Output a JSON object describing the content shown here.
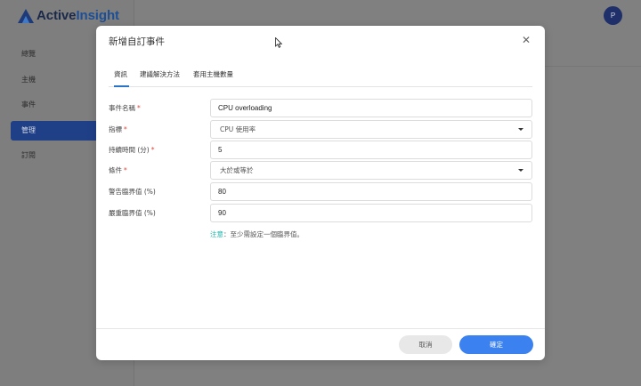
{
  "app": {
    "logo_part1": "Active",
    "logo_part2": "Insight",
    "avatar_initial": "P"
  },
  "sidebar": {
    "items": [
      {
        "label": "總覽"
      },
      {
        "label": "主機"
      },
      {
        "label": "事件"
      },
      {
        "label": "管理",
        "active": true
      },
      {
        "label": "訂閱"
      }
    ]
  },
  "modal": {
    "title": "新增自訂事件",
    "close_icon": "close-icon",
    "tabs": [
      {
        "label": "資訊",
        "active": true
      },
      {
        "label": "建議解決方法"
      },
      {
        "label": "套用主機數量"
      }
    ],
    "form": {
      "event_name": {
        "label": "事件名稱",
        "required": "*",
        "value": "CPU overloading"
      },
      "metric": {
        "label": "指標",
        "required": "*",
        "value": "CPU 使用率"
      },
      "duration": {
        "label": "持續時間 (分)",
        "required": "*",
        "value": "5"
      },
      "condition": {
        "label": "條件",
        "required": "*",
        "value": "大於或等於"
      },
      "warning_threshold": {
        "label": "警告臨界值 (%)",
        "value": "80"
      },
      "critical_threshold": {
        "label": "嚴重臨界值 (%)",
        "value": "90"
      }
    },
    "note_prefix": "注意",
    "note_text": "：至少需設定一個臨界值。",
    "cancel_label": "取消",
    "ok_label": "確定"
  },
  "colors": {
    "accent": "#3b82f0",
    "sidebar_active": "#1f3f87",
    "required": "#e0453a",
    "note": "#1bb3a7"
  }
}
